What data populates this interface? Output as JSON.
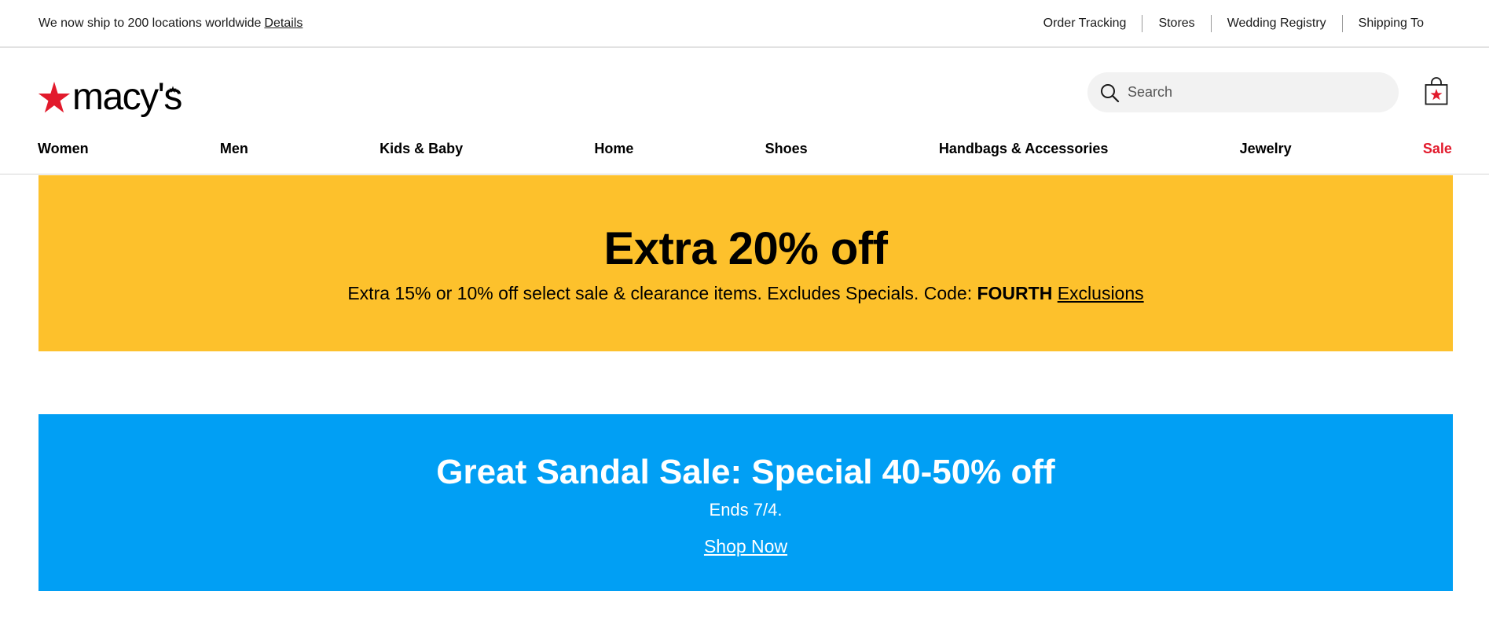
{
  "utility": {
    "ship_message": "We now ship to 200 locations worldwide",
    "details_link": "Details",
    "links": [
      "Order Tracking",
      "Stores",
      "Wedding Registry",
      "Shipping To"
    ]
  },
  "header": {
    "logo_text": "macy's",
    "logo_star_icon": "red-star-icon",
    "search_placeholder": "Search",
    "search_icon": "search-icon",
    "bag_icon": "shopping-bag-icon"
  },
  "nav": {
    "items": [
      "Women",
      "Men",
      "Kids & Baby",
      "Home",
      "Shoes",
      "Handbags & Accessories",
      "Jewelry",
      "Sale"
    ]
  },
  "promo_yellow": {
    "headline": "Extra 20% off",
    "sub_text": "Extra 15% or 10% off select sale & clearance items. Excludes Specials. Code:",
    "code": "FOURTH",
    "link": "Exclusions",
    "bg_color": "#fdc12c"
  },
  "promo_blue": {
    "headline": "Great Sandal Sale: Special 40-50% off",
    "sub_text": "Ends 7/4.",
    "cta": "Shop Now",
    "bg_color": "#019ff4"
  },
  "colors": {
    "brand_red": "#e21a2c"
  }
}
